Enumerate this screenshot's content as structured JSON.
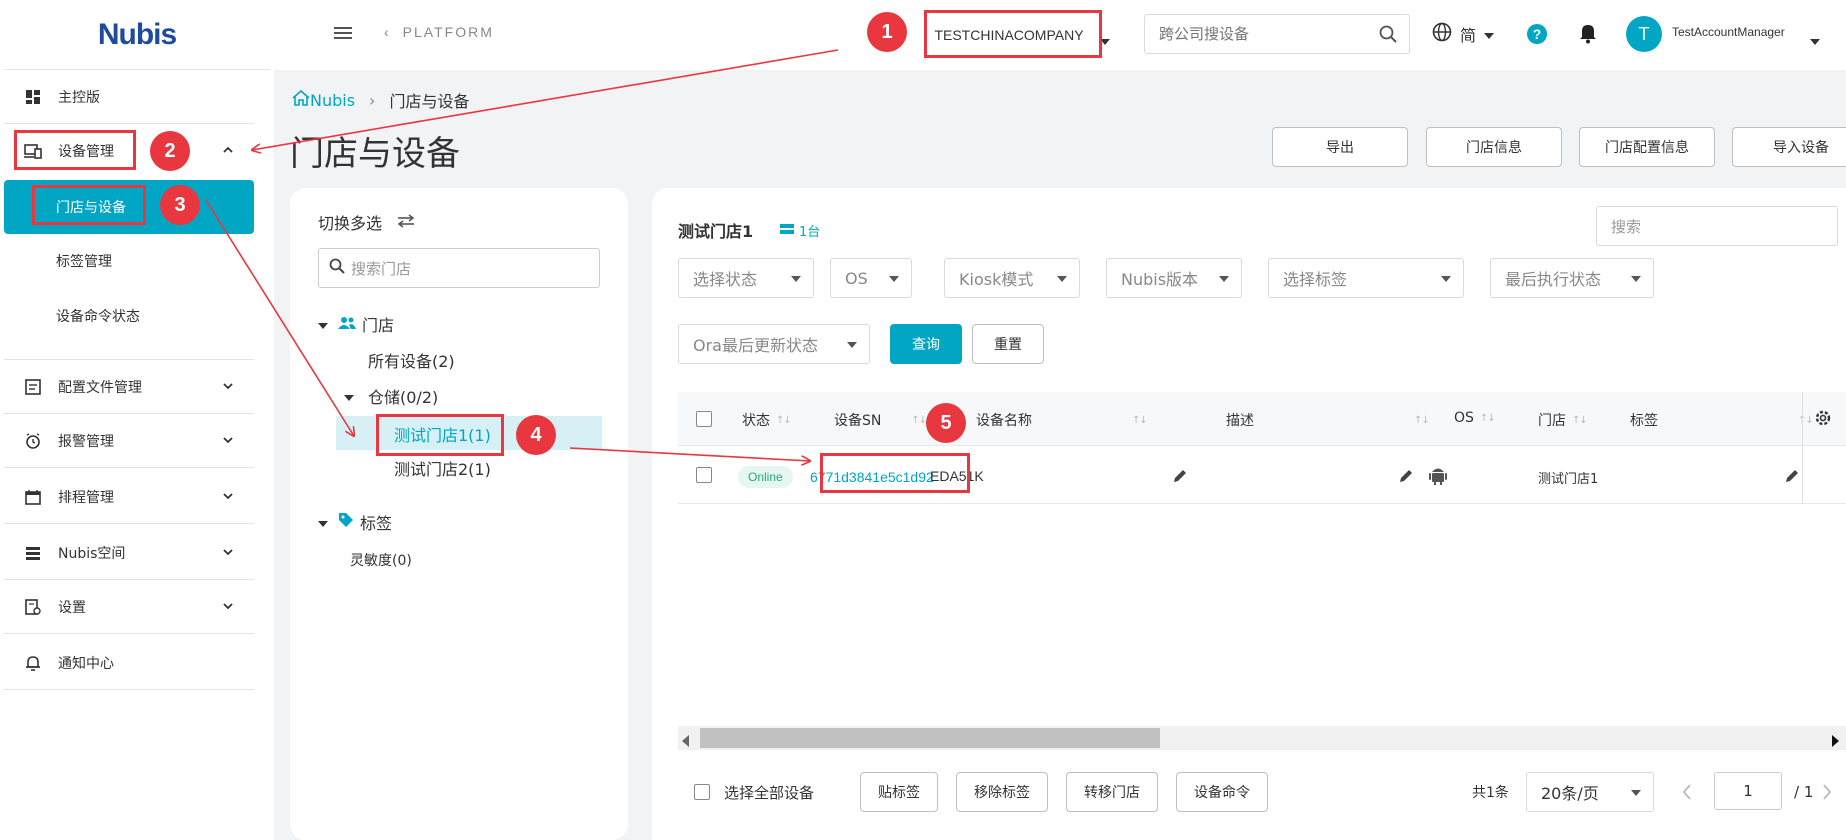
{
  "brand": {
    "logo_text": "Nubis"
  },
  "sidebar": {
    "items": [
      {
        "label": "主控版"
      },
      {
        "label": "设备管理"
      },
      {
        "label": "门店与设备"
      },
      {
        "label": "标签管理"
      },
      {
        "label": "设备命令状态"
      },
      {
        "label": "配置文件管理"
      },
      {
        "label": "报警管理"
      },
      {
        "label": "排程管理"
      },
      {
        "label": "Nubis空间"
      },
      {
        "label": "设置"
      },
      {
        "label": "通知中心"
      }
    ]
  },
  "topbar": {
    "platform": "PLATFORM",
    "company": "TESTCHINACOMPANY",
    "search_placeholder": "跨公司搜设备",
    "language": "简",
    "avatar_letter": "T",
    "username": "TestAccountManager"
  },
  "breadcrumb": {
    "home": "Nubis",
    "current": "门店与设备"
  },
  "page": {
    "title": "门店与设备",
    "buttons": [
      "导出",
      "门店信息",
      "门店配置信息",
      "导入设备"
    ]
  },
  "store_panel": {
    "toggle_label": "切换多选",
    "search_placeholder": "搜索门店",
    "stores_root": "门店",
    "all_devices": "所有设备(2)",
    "warehouse": "仓储(0/2)",
    "store1": "测试门店1(1)",
    "store2": "测试门店2(1)",
    "tags_root": "标签",
    "tag1": "灵敏度(0)"
  },
  "device_panel": {
    "store_name": "测试门店1",
    "device_count": "1台",
    "search_placeholder": "搜索",
    "filters": [
      "选择状态",
      "OS",
      "Kiosk模式",
      "Nubis版本",
      "选择标签",
      "最后执行状态",
      "Ora最后更新状态"
    ],
    "query_label": "查询",
    "reset_label": "重置"
  },
  "table": {
    "columns": [
      "状态",
      "设备SN",
      "设备名称",
      "描述",
      "OS",
      "门店",
      "标签"
    ],
    "rows": [
      {
        "status": "Online",
        "sn": "6771d3841e5c1d92",
        "name": "EDA51K",
        "description": "",
        "os": "android",
        "store": "测试门店1",
        "tags": ""
      }
    ]
  },
  "footer": {
    "select_all": "选择全部设备",
    "buttons": [
      "贴标签",
      "移除标签",
      "转移门店",
      "设备命令"
    ],
    "total": "共1条",
    "page_size": "20条/页",
    "page": "1",
    "page_total": "/ 1"
  },
  "annotations": [
    "1",
    "2",
    "3",
    "4",
    "5"
  ],
  "colors": {
    "accent": "#00a6c4",
    "annotation": "#e8373f",
    "online": "#26a77a"
  }
}
